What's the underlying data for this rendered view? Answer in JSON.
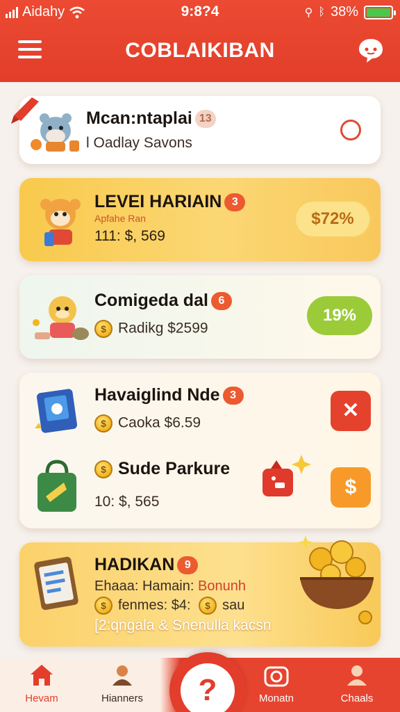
{
  "status_bar": {
    "carrier": "Aidahy",
    "time": "9:8?4",
    "battery": "38%"
  },
  "header": {
    "title": "COBLAIKIBAN"
  },
  "cards": [
    {
      "title": "Mcan:ntaplai",
      "badge": "13",
      "subtitle": "l Oadlay Savons"
    },
    {
      "title": "LEVEI HARIAIN",
      "badge": "3",
      "subtitle_small": "Apfahe Ran",
      "subtitle": "111: $, 569",
      "pill": "$72%"
    },
    {
      "title": "Comigeda dal",
      "badge": "6",
      "subtitle": "Radikg $2599",
      "pill": "19%"
    },
    {
      "title": "Havaiglind Nde",
      "badge": "3",
      "subtitle": "Caoka $6.59"
    },
    {
      "title": "Sude Parkure",
      "subtitle": "10: $, 565",
      "action": "$"
    },
    {
      "title": "HADIKAN",
      "badge": "9",
      "line1_a": "Ehaaa: Hamain:",
      "line1_b": "Bonunh",
      "line2_a": "fenmes: $4:",
      "line2_b": "sau",
      "line3": "[2:qngala & Snenulla kacsn"
    }
  ],
  "bottom_nav": [
    {
      "label": "Hevam"
    },
    {
      "label": "Hianners"
    },
    {
      "label": "?"
    },
    {
      "label": "Monatn"
    },
    {
      "label": "Chaals"
    }
  ],
  "colors": {
    "primary": "#e23e2b",
    "gold": "#f6c04a",
    "green_pill": "#9ccb3a",
    "orange_pill": "#f79a2a"
  },
  "icons": [
    "hamburger-icon",
    "chat-icon",
    "wifi-icon",
    "signal-icon",
    "battery-icon",
    "home-icon",
    "person-icon",
    "help-icon",
    "camera-icon",
    "profile-icon"
  ]
}
